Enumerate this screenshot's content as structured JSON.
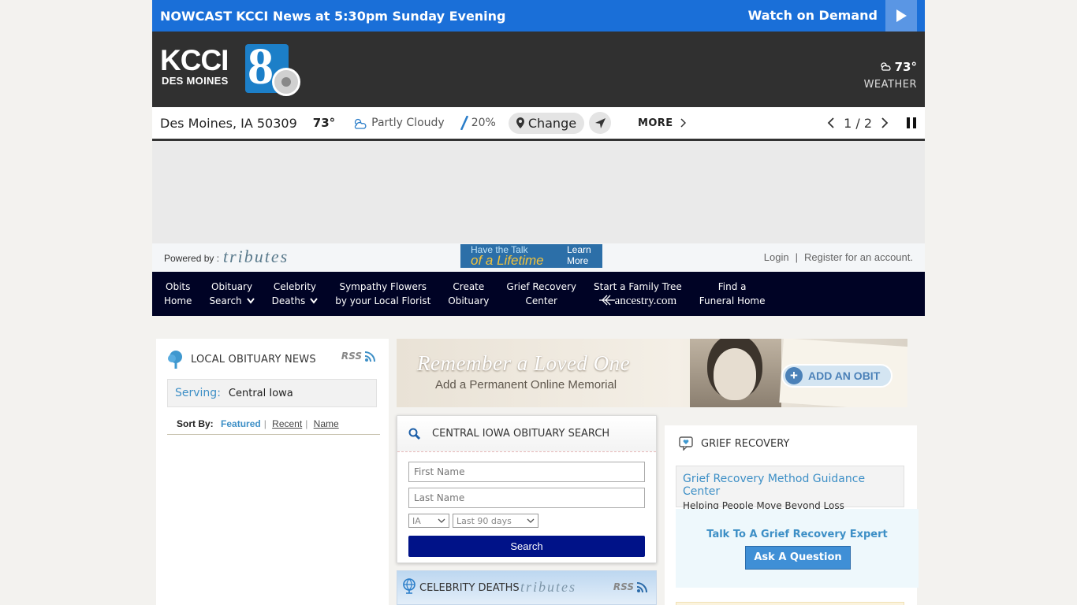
{
  "nowcast": {
    "label": "NOWCAST",
    "title": "KCCI News at 5:30pm Sunday Evening",
    "watch": "Watch on Demand",
    "play_icon": "play-icon"
  },
  "station": {
    "logo_main": "KCCI",
    "logo_sub": "DES MOINES",
    "logo_number": "8",
    "weather_temp": "73°",
    "weather_label": "WEATHER"
  },
  "weather_strip": {
    "location": "Des Moines, IA 50309",
    "temp": "73°",
    "condition": "Partly Cloudy",
    "precip": "20%",
    "change_label": "Change",
    "more_label": "MORE",
    "pager": "1 / 2"
  },
  "tributes_bar": {
    "powered_by": "Powered by :",
    "brand": "tributes",
    "ad_line1": "Have the Talk",
    "ad_line2": "of a Lifetime",
    "ad_learn": "Learn More",
    "login": "Login",
    "register": "Register for an account."
  },
  "nav": {
    "items": [
      {
        "line1": "Obits",
        "line2": "Home"
      },
      {
        "line1": "Obituary",
        "line2": "Search"
      },
      {
        "line1": "Celebrity",
        "line2": "Deaths"
      },
      {
        "line1": "Sympathy Flowers",
        "line2": "by your Local Florist"
      },
      {
        "line1": "Create",
        "line2": "Obituary"
      },
      {
        "line1": "Grief Recovery",
        "line2": "Center"
      },
      {
        "line1": "Start a Family Tree",
        "line2": "ancestry.com"
      },
      {
        "line1": "Find a",
        "line2": "Funeral Home"
      }
    ]
  },
  "local_news": {
    "title": "LOCAL OBITUARY NEWS",
    "rss": "RSS",
    "serving_label": "Serving:",
    "serving_value": "Central Iowa",
    "sort_by": "Sort By:",
    "sort_featured": "Featured",
    "sort_recent": "Recent",
    "sort_name": "Name"
  },
  "banner": {
    "headline": "Remember a Loved One",
    "subline": "Add a Permanent Online Memorial",
    "cta": "ADD AN OBIT"
  },
  "search": {
    "title": "CENTRAL IOWA OBITUARY SEARCH",
    "first_placeholder": "First Name",
    "last_placeholder": "Last Name",
    "state": "IA",
    "range": "Last 90 days",
    "button": "Search"
  },
  "celebrity": {
    "title": "CELEBRITY DEATHS",
    "brand": "tributes",
    "rss": "RSS"
  },
  "grief": {
    "title": "GRIEF RECOVERY",
    "link": "Grief Recovery Method Guidance Center",
    "sub": "Helping People Move Beyond Loss",
    "talk": "Talk To A Grief Recovery Expert",
    "ask": "Ask A Question"
  }
}
